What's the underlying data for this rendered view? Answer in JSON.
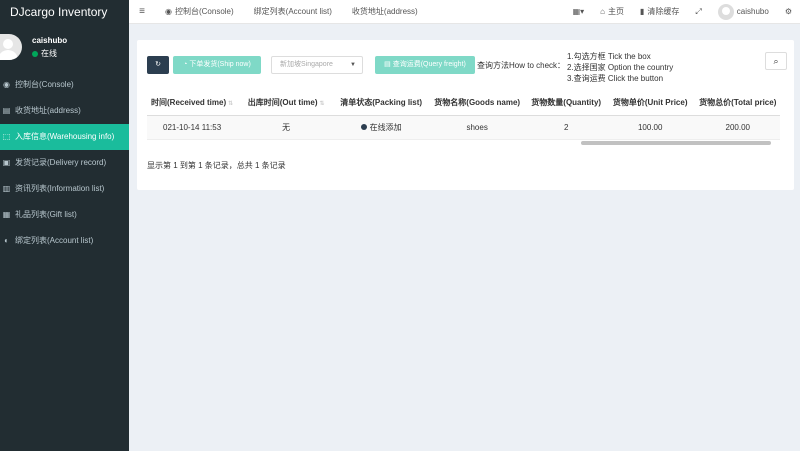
{
  "brand": "DJcargo Inventory",
  "user": {
    "name": "caishubo",
    "status": "在线"
  },
  "sidebar": {
    "items": [
      {
        "icon": "◉",
        "label": "控制台(Console)"
      },
      {
        "icon": "▤",
        "label": "收货地址(address)"
      },
      {
        "icon": "⬚",
        "label": "入库信息(Warehousing info)"
      },
      {
        "icon": "▣",
        "label": "发货记录(Delivery record)"
      },
      {
        "icon": "▥",
        "label": "资讯列表(Information list)"
      },
      {
        "icon": "▦",
        "label": "礼品列表(Gift list)"
      },
      {
        "icon": "◐",
        "label": "绑定列表(Account list)"
      }
    ]
  },
  "topbar": {
    "menu_icon": "≡",
    "nav": [
      {
        "icon": "◉",
        "label": "控制台(Console)"
      },
      {
        "icon": "",
        "label": "绑定列表(Account list)"
      },
      {
        "icon": "",
        "label": "收货地址(address)"
      }
    ],
    "grid_icon": "▦▾",
    "home_icon": "⌂",
    "home_label": "主页",
    "clear_icon": "▮",
    "clear_label": "清除缓存",
    "fullscreen_icon": "⤢",
    "username": "caishubo",
    "settings_icon": "⚙"
  },
  "toolbar": {
    "refresh_icon": "↻",
    "ship_label": "◔ 下单发货(Ship now)",
    "country_placeholder": "新加坡Singapore",
    "caret": "▼",
    "query_label": "▤ 查询运费(Query freight)",
    "howto": "查询方法How to check：",
    "steps": [
      "1.勾选方框 Tick the box",
      "2.选择国家 Option the country",
      "3.查询运费 Click the button"
    ],
    "search_icon": "⌕"
  },
  "table": {
    "columns": [
      "时间(Received time)",
      "出库时间(Out time)",
      "清单状态(Packing list)",
      "货物名称(Goods name)",
      "货物数量(Quantity)",
      "货物单价(Unit Price)",
      "货物总价(Total price)"
    ],
    "sort_icon": "⇅",
    "rows": [
      [
        "021-10-14 11:53",
        "无",
        "在线添加",
        "shoes",
        "2",
        "100.00",
        "200.00"
      ]
    ]
  },
  "footer": "显示第 1 到第 1 条记录，总共 1 条记录"
}
